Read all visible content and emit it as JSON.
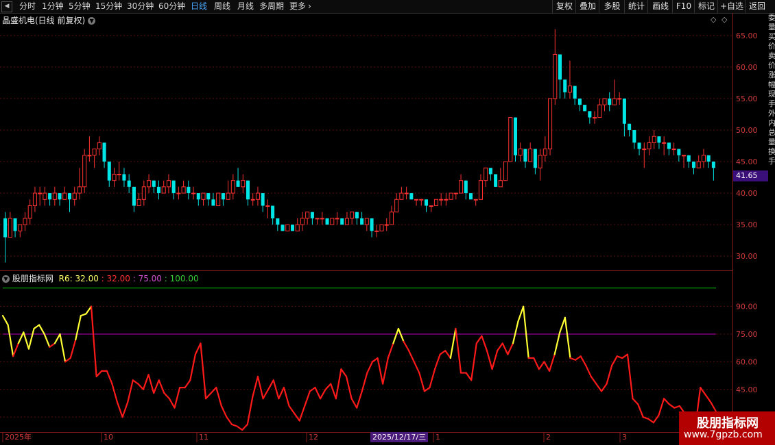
{
  "toolbar": {
    "periods": [
      "分时",
      "1分钟",
      "5分钟",
      "15分钟",
      "30分钟",
      "60分钟",
      "日线",
      "周线",
      "月线",
      "多周期",
      "更多"
    ],
    "active_period": "日线",
    "right_buttons": [
      "复权",
      "叠加",
      "多股",
      "统计",
      "画线",
      "F10",
      "标记",
      "+自选",
      "返回"
    ]
  },
  "main_title": "晶盛机电(日线 前复权)",
  "indicator": {
    "name": "股朋指标网",
    "r6_label": "R6: 32.00",
    "v1": ": 32.00",
    "v2": ": 75.00",
    "v3": ": 100.00"
  },
  "price_axis": [
    "65.00",
    "60.00",
    "55.00",
    "50.00",
    "45.00",
    "40.00",
    "35.00",
    "30.00"
  ],
  "current_price": "41.65",
  "ind_axis": [
    "90.00",
    "75.00",
    "60.00",
    "45.00",
    "30.00"
  ],
  "side_strip_text": "委量买价卖价涨幅现手外内总量换手",
  "date_axis": [
    "2025年",
    "10",
    "11",
    "12",
    "1",
    "2",
    "3"
  ],
  "crosshair_date": "2025/12/17/三",
  "watermark": {
    "line1": "股朋指标网",
    "line2": "www.7gpzb.com"
  },
  "colors": {
    "up": "#ff3232",
    "down": "#00e5e5",
    "r6_high": "#ffff33",
    "r6_low": "#ff1a1a",
    "line100": "#00c000",
    "line75": "#c000c0",
    "label32": "#ff3030",
    "label75": "#d050d0",
    "label100": "#33cc33"
  },
  "chart_data": [
    {
      "type": "candlestick",
      "title": "晶盛机电(日线 前复权)",
      "y_ticks": [
        30,
        35,
        40,
        45,
        50,
        55,
        60,
        65
      ],
      "ylim": [
        28.5,
        66.5
      ],
      "last": 41.65,
      "candles": [
        [
          36,
          33,
          37,
          29
        ],
        [
          33,
          36,
          37,
          33
        ],
        [
          36,
          34,
          36,
          33
        ],
        [
          34,
          35,
          35,
          33
        ],
        [
          35,
          36,
          37,
          34
        ],
        [
          36,
          38,
          39,
          35
        ],
        [
          38,
          40,
          41,
          37
        ],
        [
          40,
          40,
          41,
          38
        ],
        [
          39,
          40,
          41,
          38
        ],
        [
          40,
          39,
          40,
          38
        ],
        [
          39,
          40,
          41,
          38
        ],
        [
          40,
          39,
          40,
          38
        ],
        [
          39,
          40,
          41,
          39
        ],
        [
          40,
          39,
          40,
          37
        ],
        [
          39,
          40,
          41,
          38
        ],
        [
          40,
          41,
          44,
          39
        ],
        [
          41,
          46,
          47,
          40
        ],
        [
          46,
          46,
          49,
          45
        ],
        [
          46,
          47,
          47,
          44
        ],
        [
          47,
          48,
          49,
          46
        ],
        [
          48,
          45,
          48,
          44
        ],
        [
          45,
          42,
          45,
          41
        ],
        [
          42,
          43,
          44,
          41
        ],
        [
          43,
          43,
          45,
          42
        ],
        [
          43,
          42,
          44,
          41
        ],
        [
          42,
          41,
          43,
          40
        ],
        [
          41,
          38,
          41,
          37
        ],
        [
          38,
          39,
          40,
          38
        ],
        [
          39,
          41,
          42,
          38
        ],
        [
          41,
          42,
          43,
          40
        ],
        [
          42,
          41,
          42,
          40
        ],
        [
          41,
          40,
          42,
          39
        ],
        [
          40,
          41,
          42,
          40
        ],
        [
          41,
          42,
          43,
          40
        ],
        [
          42,
          40,
          42,
          39
        ],
        [
          40,
          40,
          41,
          39
        ],
        [
          40,
          41,
          42,
          40
        ],
        [
          41,
          40,
          42,
          39
        ],
        [
          40,
          40,
          41,
          39
        ],
        [
          40,
          39,
          40,
          38
        ],
        [
          39,
          40,
          40,
          38
        ],
        [
          40,
          39,
          40,
          38
        ],
        [
          39,
          38,
          40,
          38
        ],
        [
          38,
          40,
          40,
          38
        ],
        [
          40,
          39,
          40,
          38
        ],
        [
          39,
          40,
          42,
          39
        ],
        [
          40,
          42,
          43,
          39
        ],
        [
          42,
          41,
          44,
          41
        ],
        [
          41,
          42,
          43,
          40
        ],
        [
          42,
          39,
          42,
          38
        ],
        [
          39,
          39,
          40,
          38
        ],
        [
          39,
          40,
          41,
          38
        ],
        [
          40,
          38,
          40,
          37
        ],
        [
          38,
          38,
          39,
          36
        ],
        [
          38,
          36,
          38,
          35
        ],
        [
          36,
          35,
          36,
          34
        ],
        [
          35,
          34,
          35,
          34
        ],
        [
          34,
          35,
          35,
          34
        ],
        [
          35,
          34,
          35,
          34
        ],
        [
          34,
          35,
          36,
          34
        ],
        [
          35,
          36,
          37,
          34
        ],
        [
          36,
          37,
          37,
          35
        ],
        [
          37,
          36,
          37,
          35
        ],
        [
          36,
          36,
          36,
          35
        ],
        [
          36,
          36,
          37,
          35
        ],
        [
          36,
          35,
          36,
          35
        ],
        [
          35,
          36,
          36,
          35
        ],
        [
          36,
          36,
          37,
          35
        ],
        [
          36,
          35,
          36,
          35
        ],
        [
          35,
          36,
          37,
          35
        ],
        [
          36,
          37,
          37,
          35
        ],
        [
          37,
          36,
          37,
          35
        ],
        [
          36,
          35,
          37,
          35
        ],
        [
          35,
          36,
          36,
          34
        ],
        [
          36,
          34,
          36,
          33
        ],
        [
          34,
          34,
          35,
          33
        ],
        [
          34,
          35,
          35,
          34
        ],
        [
          35,
          35,
          36,
          34
        ],
        [
          35,
          37,
          38,
          35
        ],
        [
          37,
          39,
          40,
          37
        ],
        [
          39,
          40,
          41,
          39
        ],
        [
          40,
          40,
          41,
          39
        ],
        [
          40,
          39,
          40,
          39
        ],
        [
          39,
          39,
          39,
          38
        ],
        [
          39,
          39,
          39,
          38
        ],
        [
          39,
          38,
          39,
          37
        ],
        [
          38,
          38,
          38,
          37
        ],
        [
          38,
          39,
          39,
          38
        ],
        [
          39,
          39,
          40,
          38
        ],
        [
          39,
          39,
          40,
          38
        ],
        [
          39,
          40,
          40,
          39
        ],
        [
          40,
          40,
          40,
          39
        ],
        [
          40,
          42,
          43,
          40
        ],
        [
          42,
          40,
          42,
          39
        ],
        [
          40,
          39,
          40,
          39
        ],
        [
          39,
          39,
          39,
          38
        ],
        [
          39,
          42,
          43,
          39
        ],
        [
          42,
          44,
          44,
          41
        ],
        [
          44,
          43,
          44,
          42
        ],
        [
          43,
          41,
          43,
          41
        ],
        [
          41,
          42,
          44,
          41
        ],
        [
          42,
          45,
          45,
          42
        ],
        [
          45,
          52,
          52,
          45
        ],
        [
          52,
          46,
          52,
          45
        ],
        [
          46,
          47,
          48,
          45
        ],
        [
          47,
          45,
          47,
          44
        ],
        [
          45,
          47,
          48,
          45
        ],
        [
          47,
          44,
          47,
          43
        ],
        [
          44,
          46,
          47,
          42
        ],
        [
          46,
          47,
          49,
          45
        ],
        [
          47,
          55,
          55,
          46
        ],
        [
          55,
          62,
          66,
          54
        ],
        [
          62,
          58,
          60,
          55
        ],
        [
          58,
          56,
          58,
          55
        ],
        [
          56,
          57,
          61,
          55
        ],
        [
          57,
          55,
          57,
          54
        ],
        [
          55,
          54,
          55,
          53
        ],
        [
          54,
          53,
          54,
          53
        ],
        [
          53,
          52,
          53,
          51
        ],
        [
          52,
          52,
          53,
          51
        ],
        [
          52,
          54,
          55,
          52
        ],
        [
          54,
          55,
          55,
          53
        ],
        [
          55,
          54,
          56,
          53
        ],
        [
          54,
          55,
          58,
          54
        ],
        [
          55,
          55,
          56,
          54
        ],
        [
          55,
          51,
          55,
          49
        ],
        [
          51,
          50,
          51,
          49
        ],
        [
          50,
          48,
          50,
          47
        ],
        [
          48,
          47,
          48,
          46
        ],
        [
          47,
          47,
          48,
          44
        ],
        [
          47,
          48,
          49,
          46
        ],
        [
          48,
          49,
          50,
          47
        ],
        [
          49,
          48,
          49,
          47
        ],
        [
          48,
          48,
          49,
          46
        ],
        [
          48,
          47,
          48,
          46
        ],
        [
          47,
          47,
          48,
          46
        ],
        [
          47,
          46,
          47,
          45
        ],
        [
          46,
          46,
          46,
          44
        ],
        [
          46,
          45,
          46,
          44
        ],
        [
          45,
          44,
          45,
          43
        ],
        [
          44,
          45,
          46,
          44
        ],
        [
          45,
          46,
          47,
          44
        ],
        [
          46,
          45,
          46,
          44
        ],
        [
          45,
          44,
          45,
          42
        ]
      ]
    },
    {
      "type": "line",
      "name": "股朋指标网 R6",
      "y_ticks": [
        30,
        45,
        60,
        75,
        90
      ],
      "ylim": [
        23,
        104
      ],
      "threshold_high": 75,
      "ref_lines": [
        75,
        100
      ],
      "values": [
        85,
        80,
        63,
        70,
        76,
        67,
        78,
        80,
        75,
        68,
        70,
        75,
        60,
        62,
        72,
        85,
        86,
        90,
        52,
        55,
        55,
        48,
        38,
        30,
        38,
        50,
        48,
        45,
        53,
        43,
        50,
        43,
        40,
        35,
        46,
        46,
        50,
        64,
        70,
        40,
        43,
        46,
        36,
        30,
        26,
        25,
        23,
        26,
        41,
        52,
        40,
        45,
        50,
        40,
        46,
        36,
        32,
        28,
        36,
        44,
        46,
        40,
        45,
        48,
        40,
        56,
        52,
        40,
        35,
        44,
        54,
        60,
        62,
        48,
        62,
        70,
        78,
        71,
        66,
        60,
        54,
        44,
        46,
        56,
        64,
        66,
        62,
        78,
        54,
        54,
        50,
        70,
        74,
        66,
        56,
        66,
        70,
        64,
        70,
        82,
        90,
        62,
        62,
        56,
        60,
        55,
        64,
        76,
        84,
        62,
        61,
        63,
        58,
        52,
        48,
        44,
        48,
        58,
        63,
        62,
        64,
        40,
        37,
        30,
        29,
        27,
        31,
        40,
        37,
        35,
        36,
        32,
        24,
        24,
        46,
        42,
        38,
        33
      ]
    }
  ]
}
